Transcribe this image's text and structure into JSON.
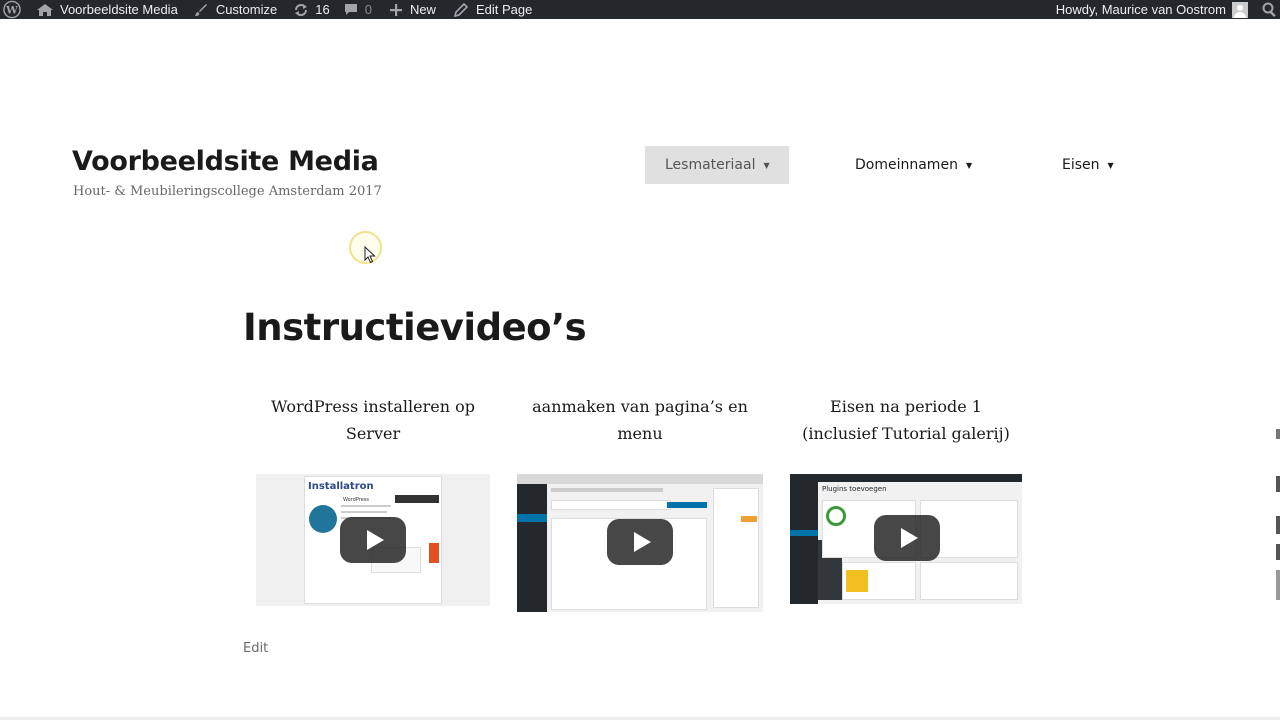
{
  "admin_bar": {
    "site_name": "Voorbeeldsite Media",
    "customize": "Customize",
    "updates_count": "16",
    "comments_count": "0",
    "new_label": "New",
    "edit_page": "Edit Page",
    "howdy": "Howdy, Maurice van Oostrom"
  },
  "header": {
    "site_title": "Voorbeeldsite Media",
    "site_description": "Hout- & Meubileringscollege Amsterdam 2017"
  },
  "nav": {
    "items": [
      {
        "label": "Lesmateriaal",
        "active": true
      },
      {
        "label": "Domeinnamen",
        "active": false
      },
      {
        "label": "Eisen",
        "active": false
      }
    ]
  },
  "page": {
    "heading": "Instructievideo’s",
    "videos": [
      {
        "title_line1": "WordPress installeren op",
        "title_line2": "Server",
        "thumb_text": "Installatron",
        "thumb_sub": "WordPress"
      },
      {
        "title_line1": "aanmaken van pagina’s en",
        "title_line2": "menu",
        "thumb_text": "",
        "thumb_sub": ""
      },
      {
        "title_line1": "Eisen na periode 1",
        "title_line2": "(inclusief Tutorial galerij)",
        "thumb_text": "Plugins toevoegen",
        "thumb_sub": ""
      }
    ],
    "edit_label": "Edit"
  },
  "colors": {
    "admin_bar_bg": "#23282d",
    "active_nav_bg": "#e0e0e0",
    "wp_admin_blue": "#0073aa",
    "wp_sidebar": "#23282d"
  }
}
